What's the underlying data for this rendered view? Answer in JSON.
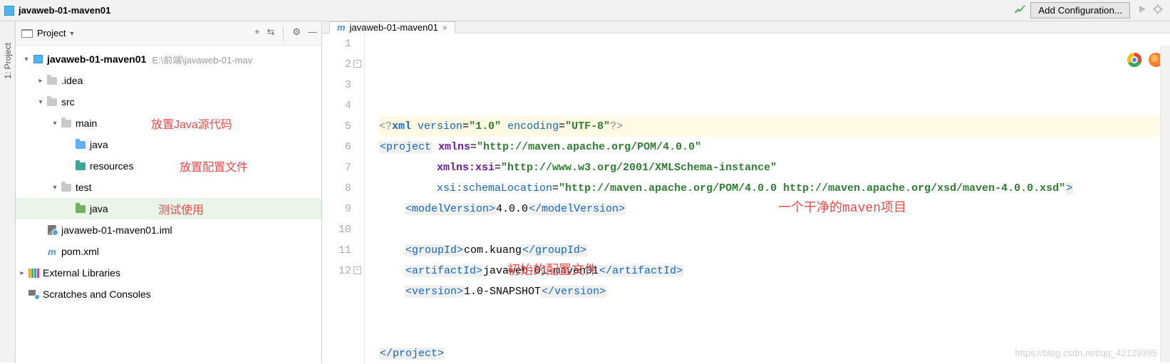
{
  "topbar": {
    "crumb": "javaweb-01-maven01",
    "config_btn": "Add Configuration..."
  },
  "sidebar": {
    "tab_label": "1: Project"
  },
  "tree_header": {
    "title": "Project"
  },
  "tree": {
    "root": {
      "name": "javaweb-01-maven01",
      "path": "E:\\前端\\javaweb-01-mav"
    },
    "idea": ".idea",
    "src": "src",
    "main": "main",
    "java": "java",
    "resources": "resources",
    "test": "test",
    "test_java": "java",
    "iml": "javaweb-01-maven01.iml",
    "pom": "pom.xml",
    "ext": "External Libraries",
    "scratches": "Scratches and Consoles",
    "anno_java": "放置Java源代码",
    "anno_resources": "放置配置文件",
    "anno_test": "测试使用"
  },
  "tab": {
    "label": "javaweb-01-maven01"
  },
  "editor_annotations": {
    "clean": "一个干净的maven项目",
    "initial": "初始的配置文件"
  },
  "code": {
    "lines": [
      {
        "n": 1,
        "kind": "pi",
        "text": "<?xml version=\"1.0\" encoding=\"UTF-8\"?>"
      },
      {
        "n": 2,
        "kind": "project_open",
        "xmlns": "http://maven.apache.org/POM/4.0.0"
      },
      {
        "n": 3,
        "kind": "xsi",
        "val": "http://www.w3.org/2001/XMLSchema-instance"
      },
      {
        "n": 4,
        "kind": "schemaloc",
        "val": "http://maven.apache.org/POM/4.0.0 http://maven.apache.org/xsd/maven-4.0.0.xsd"
      },
      {
        "n": 5,
        "kind": "elem",
        "tag": "modelVersion",
        "val": "4.0.0"
      },
      {
        "n": 6,
        "kind": "blank"
      },
      {
        "n": 7,
        "kind": "elem",
        "tag": "groupId",
        "val": "com.kuang"
      },
      {
        "n": 8,
        "kind": "elem",
        "tag": "artifactId",
        "val": "javaweb-01-maven01"
      },
      {
        "n": 9,
        "kind": "elem",
        "tag": "version",
        "val": "1.0-SNAPSHOT"
      },
      {
        "n": 10,
        "kind": "blank"
      },
      {
        "n": 11,
        "kind": "blank"
      },
      {
        "n": 12,
        "kind": "project_close"
      }
    ]
  },
  "watermark": "https://blog.csdn.net/qq_42129395"
}
